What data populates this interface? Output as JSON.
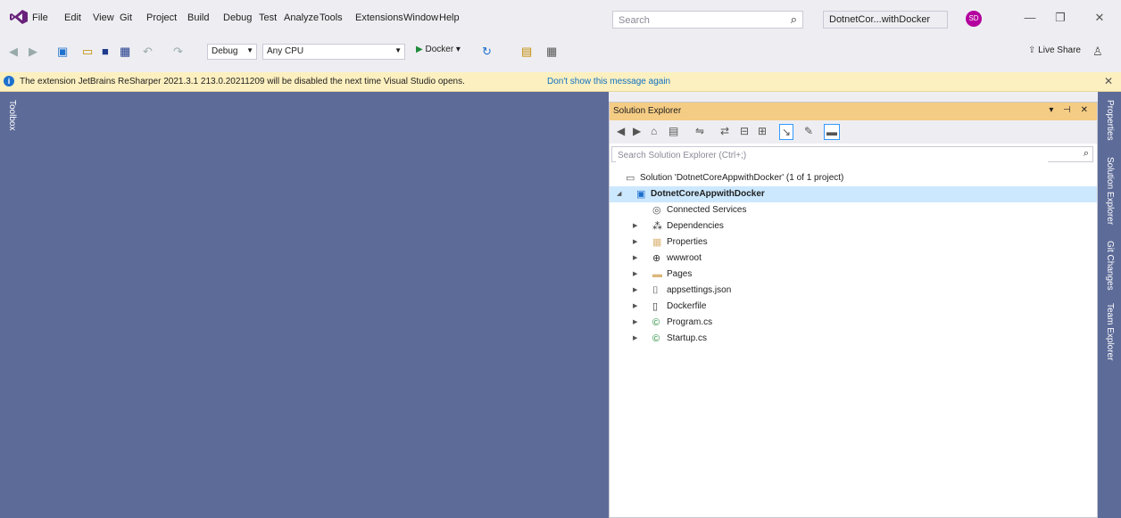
{
  "menu": [
    "File",
    "Edit",
    "View",
    "Git",
    "Project",
    "Build",
    "Debug",
    "Test",
    "Analyze",
    "Tools",
    "Extensions",
    "Window",
    "Help"
  ],
  "search": {
    "placeholder": "Search"
  },
  "solution_title": "DotnetCor...withDocker",
  "avatar_initials": "SD",
  "window_controls": {
    "minimize": "—",
    "restore": "❐",
    "close": "✕"
  },
  "toolbar": {
    "config": "Debug",
    "platform": "Any CPU",
    "run_target": "Docker",
    "live_share": "Live Share"
  },
  "infobar": {
    "message": "The extension JetBrains ReSharper 2021.3.1 213.0.20211209 will be disabled the next time Visual Studio opens.",
    "link": "Don't show this message again"
  },
  "left_tab": "Toolbox",
  "solution_explorer": {
    "title": "Solution Explorer",
    "title_buttons": "▾ ⊣ ✕",
    "search_placeholder": "Search Solution Explorer (Ctrl+;)",
    "tree": [
      {
        "label": "Solution 'DotnetCoreAppwithDocker' (1 of 1 project)",
        "icon": "solution-icon",
        "level": 0,
        "expander": "",
        "bold": false
      },
      {
        "label": "DotnetCoreAppwithDocker",
        "icon": "project-icon",
        "level": 0,
        "expander": "◢",
        "bold": true,
        "selected": true
      },
      {
        "label": "Connected Services",
        "icon": "connected-services-icon",
        "level": 1,
        "expander": "",
        "bold": false
      },
      {
        "label": "Dependencies",
        "icon": "dependencies-icon",
        "level": 1,
        "expander": "▶",
        "bold": false
      },
      {
        "label": "Properties",
        "icon": "properties-folder-icon",
        "level": 1,
        "expander": "▶",
        "bold": false
      },
      {
        "label": "wwwroot",
        "icon": "globe-icon",
        "level": 1,
        "expander": "▶",
        "bold": false
      },
      {
        "label": "Pages",
        "icon": "folder-icon",
        "level": 1,
        "expander": "▶",
        "bold": false
      },
      {
        "label": "appsettings.json",
        "icon": "json-file-icon",
        "level": 1,
        "expander": "▶",
        "bold": false
      },
      {
        "label": "Dockerfile",
        "icon": "file-icon",
        "level": 1,
        "expander": "▶",
        "bold": false
      },
      {
        "label": "Program.cs",
        "icon": "csharp-file-icon",
        "level": 1,
        "expander": "▶",
        "bold": false
      },
      {
        "label": "Startup.cs",
        "icon": "csharp-file-icon",
        "level": 1,
        "expander": "▶",
        "bold": false
      }
    ]
  },
  "right_tabs": [
    "Properties",
    "Solution Explorer",
    "Git Changes",
    "Team Explorer"
  ],
  "colors": {
    "accent": "#f5cc84",
    "editor_bg": "#5d6b99",
    "selection": "#cce8ff",
    "brand": "#68217a"
  }
}
